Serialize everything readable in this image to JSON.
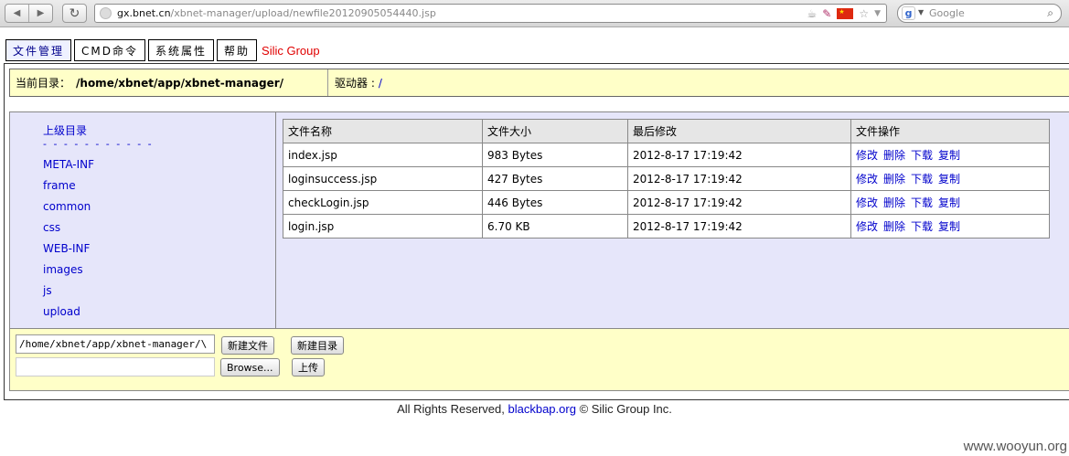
{
  "browser": {
    "url_host": "gx.bnet.cn",
    "url_path": "/xbnet-manager/upload/newfile20120905054440.jsp",
    "search_placeholder": "Google",
    "search_engine_icon": "g-icon",
    "nav_back_icon": "back-arrow-icon",
    "nav_forward_icon": "forward-arrow-icon",
    "reload_icon": "reload-icon",
    "url_icons": [
      "java-icon",
      "feather-icon",
      "china-flag-icon",
      "star-icon",
      "dropdown-icon"
    ]
  },
  "tabs": [
    {
      "label": "文件管理"
    },
    {
      "label": "CMD命令"
    },
    {
      "label": "系统属性"
    },
    {
      "label": "帮助"
    }
  ],
  "brand": "Silic Group",
  "pathbar": {
    "current_dir_label": "当前目录：",
    "current_dir_value": "/home/xbnet/app/xbnet-manager/",
    "drive_label": "驱动器 :",
    "drive_value": "/"
  },
  "dirs": {
    "parent_label": "上级目录",
    "separator": "- - - - - - - - - - -",
    "items": [
      "META-INF",
      "frame",
      "common",
      "css",
      "WEB-INF",
      "images",
      "js",
      "upload"
    ]
  },
  "files": {
    "headers": {
      "name": "文件名称",
      "size": "文件大小",
      "modified": "最后修改",
      "ops": "文件操作"
    },
    "rows": [
      {
        "name": "index.jsp",
        "size": "983 Bytes",
        "modified": "2012-8-17 17:19:42"
      },
      {
        "name": "loginsuccess.jsp",
        "size": "427 Bytes",
        "modified": "2012-8-17 17:19:42"
      },
      {
        "name": "checkLogin.jsp",
        "size": "446 Bytes",
        "modified": "2012-8-17 17:19:42"
      },
      {
        "name": "login.jsp",
        "size": "6.70 KB",
        "modified": "2012-8-17 17:19:42"
      }
    ],
    "ops": {
      "edit": "修改",
      "delete": "删除",
      "download": "下载",
      "copy": "复制"
    }
  },
  "bottom": {
    "path_input_value": "/home/xbnet/app/xbnet-manager/\\",
    "new_file_label": "新建文件",
    "new_dir_label": "新建目录",
    "browse_label": "Browse...",
    "upload_label": "上传"
  },
  "footer": {
    "prefix": "All Rights Reserved,",
    "link": "blackbap.org",
    "suffix": "© Silic Group Inc."
  },
  "watermark": "www.wooyun.org",
  "colors": {
    "pathbar_bg": "#ffffc8",
    "content_bg": "#e6e6fa",
    "link": "#0000cc",
    "brand": "#e00000"
  }
}
